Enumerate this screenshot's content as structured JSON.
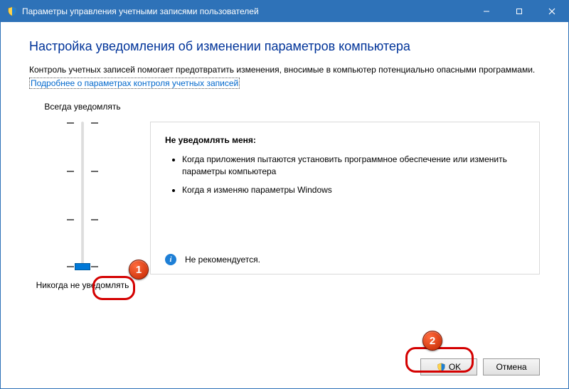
{
  "window": {
    "title": "Параметры управления учетными записями пользователей"
  },
  "heading": "Настройка уведомления об изменении параметров компьютера",
  "description": "Контроль учетных записей помогает предотвратить изменения, вносимые в компьютер потенциально опасными программами.",
  "link_text": "Подробнее о параметрах контроля учетных записей",
  "slider": {
    "top_label": "Всегда уведомлять",
    "bottom_label": "Никогда не уведомлять",
    "levels": 4,
    "selected_index": 3
  },
  "panel": {
    "title": "Не уведомлять меня:",
    "items": [
      "Когда приложения пытаются установить программное обеспечение или изменить параметры компьютера",
      "Когда я изменяю параметры Windows"
    ],
    "footer": "Не рекомендуется."
  },
  "buttons": {
    "ok": "OK",
    "cancel": "Отмена"
  },
  "annotations": {
    "badge1": "1",
    "badge2": "2"
  }
}
